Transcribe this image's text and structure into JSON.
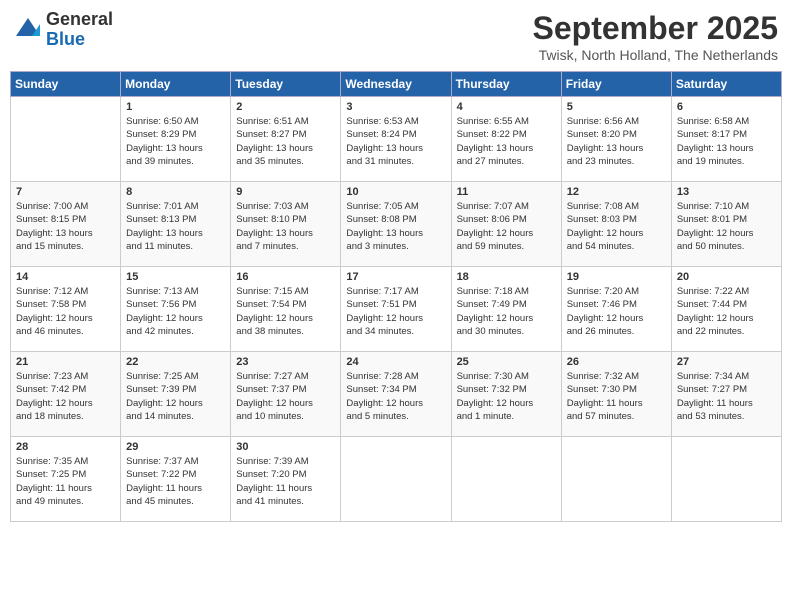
{
  "header": {
    "logo_line1": "General",
    "logo_line2": "Blue",
    "month": "September 2025",
    "location": "Twisk, North Holland, The Netherlands"
  },
  "weekdays": [
    "Sunday",
    "Monday",
    "Tuesday",
    "Wednesday",
    "Thursday",
    "Friday",
    "Saturday"
  ],
  "weeks": [
    [
      {
        "day": "",
        "info": ""
      },
      {
        "day": "1",
        "info": "Sunrise: 6:50 AM\nSunset: 8:29 PM\nDaylight: 13 hours\nand 39 minutes."
      },
      {
        "day": "2",
        "info": "Sunrise: 6:51 AM\nSunset: 8:27 PM\nDaylight: 13 hours\nand 35 minutes."
      },
      {
        "day": "3",
        "info": "Sunrise: 6:53 AM\nSunset: 8:24 PM\nDaylight: 13 hours\nand 31 minutes."
      },
      {
        "day": "4",
        "info": "Sunrise: 6:55 AM\nSunset: 8:22 PM\nDaylight: 13 hours\nand 27 minutes."
      },
      {
        "day": "5",
        "info": "Sunrise: 6:56 AM\nSunset: 8:20 PM\nDaylight: 13 hours\nand 23 minutes."
      },
      {
        "day": "6",
        "info": "Sunrise: 6:58 AM\nSunset: 8:17 PM\nDaylight: 13 hours\nand 19 minutes."
      }
    ],
    [
      {
        "day": "7",
        "info": "Sunrise: 7:00 AM\nSunset: 8:15 PM\nDaylight: 13 hours\nand 15 minutes."
      },
      {
        "day": "8",
        "info": "Sunrise: 7:01 AM\nSunset: 8:13 PM\nDaylight: 13 hours\nand 11 minutes."
      },
      {
        "day": "9",
        "info": "Sunrise: 7:03 AM\nSunset: 8:10 PM\nDaylight: 13 hours\nand 7 minutes."
      },
      {
        "day": "10",
        "info": "Sunrise: 7:05 AM\nSunset: 8:08 PM\nDaylight: 13 hours\nand 3 minutes."
      },
      {
        "day": "11",
        "info": "Sunrise: 7:07 AM\nSunset: 8:06 PM\nDaylight: 12 hours\nand 59 minutes."
      },
      {
        "day": "12",
        "info": "Sunrise: 7:08 AM\nSunset: 8:03 PM\nDaylight: 12 hours\nand 54 minutes."
      },
      {
        "day": "13",
        "info": "Sunrise: 7:10 AM\nSunset: 8:01 PM\nDaylight: 12 hours\nand 50 minutes."
      }
    ],
    [
      {
        "day": "14",
        "info": "Sunrise: 7:12 AM\nSunset: 7:58 PM\nDaylight: 12 hours\nand 46 minutes."
      },
      {
        "day": "15",
        "info": "Sunrise: 7:13 AM\nSunset: 7:56 PM\nDaylight: 12 hours\nand 42 minutes."
      },
      {
        "day": "16",
        "info": "Sunrise: 7:15 AM\nSunset: 7:54 PM\nDaylight: 12 hours\nand 38 minutes."
      },
      {
        "day": "17",
        "info": "Sunrise: 7:17 AM\nSunset: 7:51 PM\nDaylight: 12 hours\nand 34 minutes."
      },
      {
        "day": "18",
        "info": "Sunrise: 7:18 AM\nSunset: 7:49 PM\nDaylight: 12 hours\nand 30 minutes."
      },
      {
        "day": "19",
        "info": "Sunrise: 7:20 AM\nSunset: 7:46 PM\nDaylight: 12 hours\nand 26 minutes."
      },
      {
        "day": "20",
        "info": "Sunrise: 7:22 AM\nSunset: 7:44 PM\nDaylight: 12 hours\nand 22 minutes."
      }
    ],
    [
      {
        "day": "21",
        "info": "Sunrise: 7:23 AM\nSunset: 7:42 PM\nDaylight: 12 hours\nand 18 minutes."
      },
      {
        "day": "22",
        "info": "Sunrise: 7:25 AM\nSunset: 7:39 PM\nDaylight: 12 hours\nand 14 minutes."
      },
      {
        "day": "23",
        "info": "Sunrise: 7:27 AM\nSunset: 7:37 PM\nDaylight: 12 hours\nand 10 minutes."
      },
      {
        "day": "24",
        "info": "Sunrise: 7:28 AM\nSunset: 7:34 PM\nDaylight: 12 hours\nand 5 minutes."
      },
      {
        "day": "25",
        "info": "Sunrise: 7:30 AM\nSunset: 7:32 PM\nDaylight: 12 hours\nand 1 minute."
      },
      {
        "day": "26",
        "info": "Sunrise: 7:32 AM\nSunset: 7:30 PM\nDaylight: 11 hours\nand 57 minutes."
      },
      {
        "day": "27",
        "info": "Sunrise: 7:34 AM\nSunset: 7:27 PM\nDaylight: 11 hours\nand 53 minutes."
      }
    ],
    [
      {
        "day": "28",
        "info": "Sunrise: 7:35 AM\nSunset: 7:25 PM\nDaylight: 11 hours\nand 49 minutes."
      },
      {
        "day": "29",
        "info": "Sunrise: 7:37 AM\nSunset: 7:22 PM\nDaylight: 11 hours\nand 45 minutes."
      },
      {
        "day": "30",
        "info": "Sunrise: 7:39 AM\nSunset: 7:20 PM\nDaylight: 11 hours\nand 41 minutes."
      },
      {
        "day": "",
        "info": ""
      },
      {
        "day": "",
        "info": ""
      },
      {
        "day": "",
        "info": ""
      },
      {
        "day": "",
        "info": ""
      }
    ]
  ]
}
